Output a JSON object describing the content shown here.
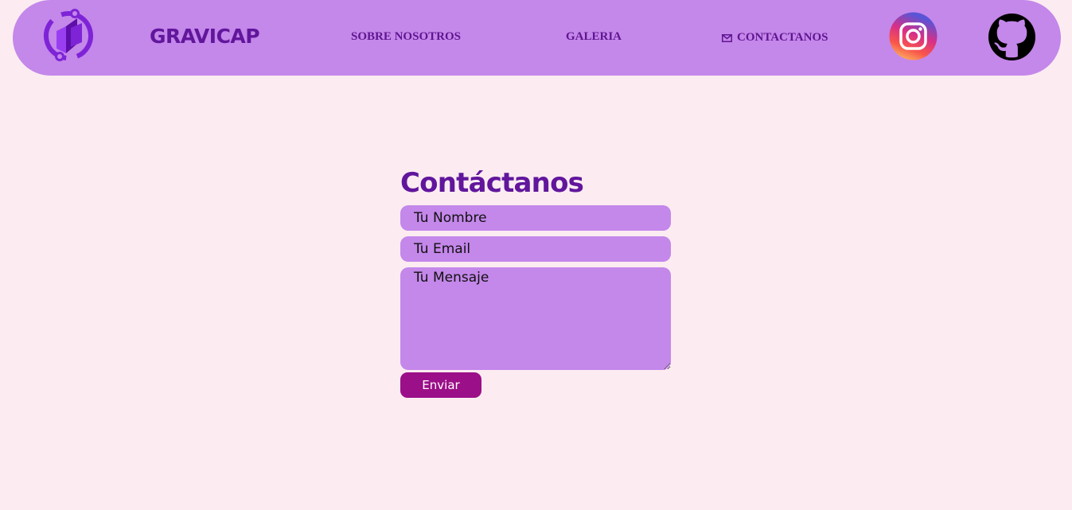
{
  "nav": {
    "brand": "GRAVICAP",
    "links": [
      {
        "label": "SOBRE NOSOTROS"
      },
      {
        "label": "GALERIA"
      },
      {
        "label": "CONTACTANOS",
        "icon": "mail-icon"
      }
    ],
    "icons": [
      "logo-icon",
      "instagram-icon",
      "github-icon"
    ]
  },
  "contact": {
    "title": "Contáctanos",
    "name_placeholder": "Tu Nombre",
    "email_placeholder": "Tu Email",
    "message_placeholder": "Tu Mensaje",
    "submit_label": "Enviar"
  },
  "colors": {
    "background": "#fcecf1",
    "navbar": "#c487ea",
    "brand_text": "#61169c",
    "button": "#9b0f88"
  }
}
